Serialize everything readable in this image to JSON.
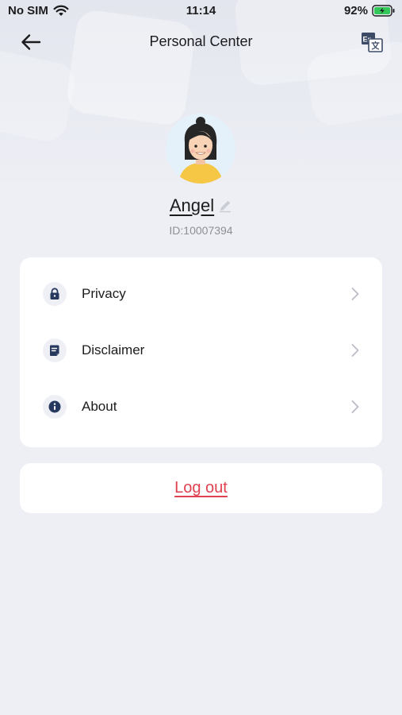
{
  "status_bar": {
    "carrier": "No SIM",
    "time": "11:14",
    "battery": "92%",
    "icons": [
      "wifi-icon",
      "battery-charging-icon"
    ]
  },
  "nav": {
    "title": "Personal Center",
    "back_icon": "arrow-left-icon",
    "language_icon": "translate-icon"
  },
  "profile": {
    "name": "Angel",
    "id": "ID:10007394",
    "avatar_icon": "avatar-girl",
    "edit_icon": "pencil-icon"
  },
  "menu": {
    "items": [
      {
        "label": "Privacy",
        "icon": "lock-icon"
      },
      {
        "label": "Disclaimer",
        "icon": "document-icon"
      },
      {
        "label": "About",
        "icon": "info-icon"
      }
    ]
  },
  "logout": {
    "label": "Log out"
  },
  "colors": {
    "background": "#eeeff5",
    "card": "#ffffff",
    "accent_icon": "#27385f",
    "logout_text": "#e0414f",
    "secondary_text": "#8e8e93"
  }
}
